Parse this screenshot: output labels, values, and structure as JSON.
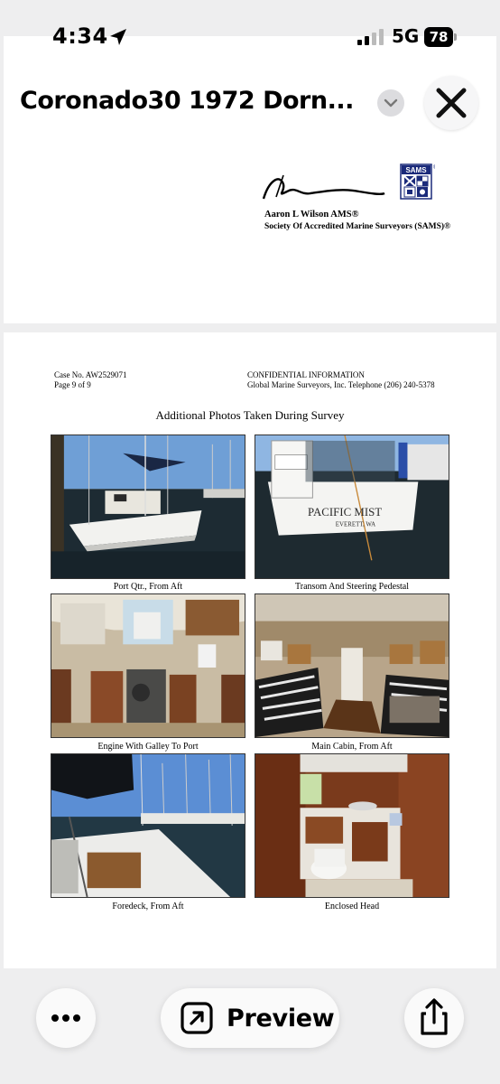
{
  "status_bar": {
    "time": "4:34",
    "network": "5G",
    "battery": "78"
  },
  "header": {
    "title": "Coronado30 1972 Dorn..."
  },
  "page1": {
    "signature_name": "Aaron L Wilson AMS®",
    "signature_org": "Society Of Accredited Marine Surveyors (SAMS)®",
    "logo_text": "SAMS"
  },
  "page2": {
    "case_no": "Case No. AW2529071",
    "page_no": "Page 9 of 9",
    "confidential": "CONFIDENTIAL INFORMATION",
    "company": "Global Marine Surveyors, Inc. Telephone (206) 240-5378",
    "heading": "Additional Photos Taken During Survey",
    "photos": [
      {
        "caption": "Port Qtr., From Aft"
      },
      {
        "caption": "Transom And Steering Pedestal",
        "boat_name": "PACIFIC MIST",
        "home_port": "EVERETT, WA"
      },
      {
        "caption": "Engine With Galley To Port"
      },
      {
        "caption": "Main Cabin, From Aft"
      },
      {
        "caption": "Foredeck, From Aft"
      },
      {
        "caption": "Enclosed Head"
      }
    ]
  },
  "bottom_bar": {
    "preview_label": "Preview"
  }
}
